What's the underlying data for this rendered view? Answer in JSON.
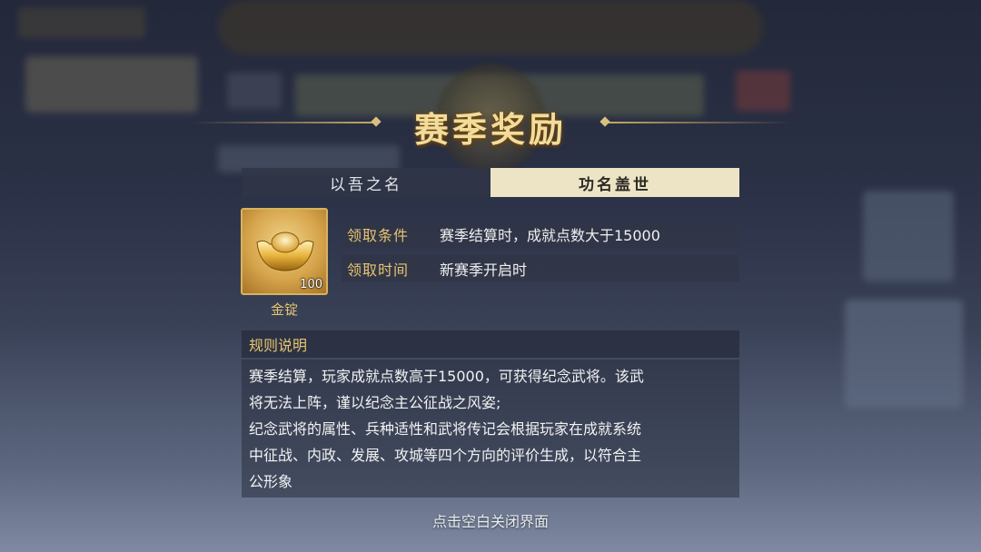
{
  "title": "赛季奖励",
  "tabs": [
    {
      "label": "以吾之名",
      "active": false
    },
    {
      "label": "功名盖世",
      "active": true
    }
  ],
  "reward": {
    "icon": "gold-ingot-icon",
    "name": "金锭",
    "count": "100"
  },
  "conditions": [
    {
      "label": "领取条件",
      "value": "赛季结算时，成就点数大于15000"
    },
    {
      "label": "领取时间",
      "value": "新赛季开启时"
    }
  ],
  "rules": {
    "title": "规则说明",
    "lines": [
      "赛季结算，玩家成就点数高于15000，可获得纪念武将。该武",
      "将无法上阵，谨以纪念主公征战之风姿;",
      "纪念武将的属性、兵种适性和武将传记会根据玩家在成就系统",
      "中征战、内政、发展、攻城等四个方向的评价生成，以符合主",
      "公形象"
    ]
  },
  "close_hint": "点击空白关闭界面",
  "colors": {
    "accent_gold": "#e6c470",
    "active_tab_bg": "#ece4c4",
    "panel_bg": "#303646"
  }
}
